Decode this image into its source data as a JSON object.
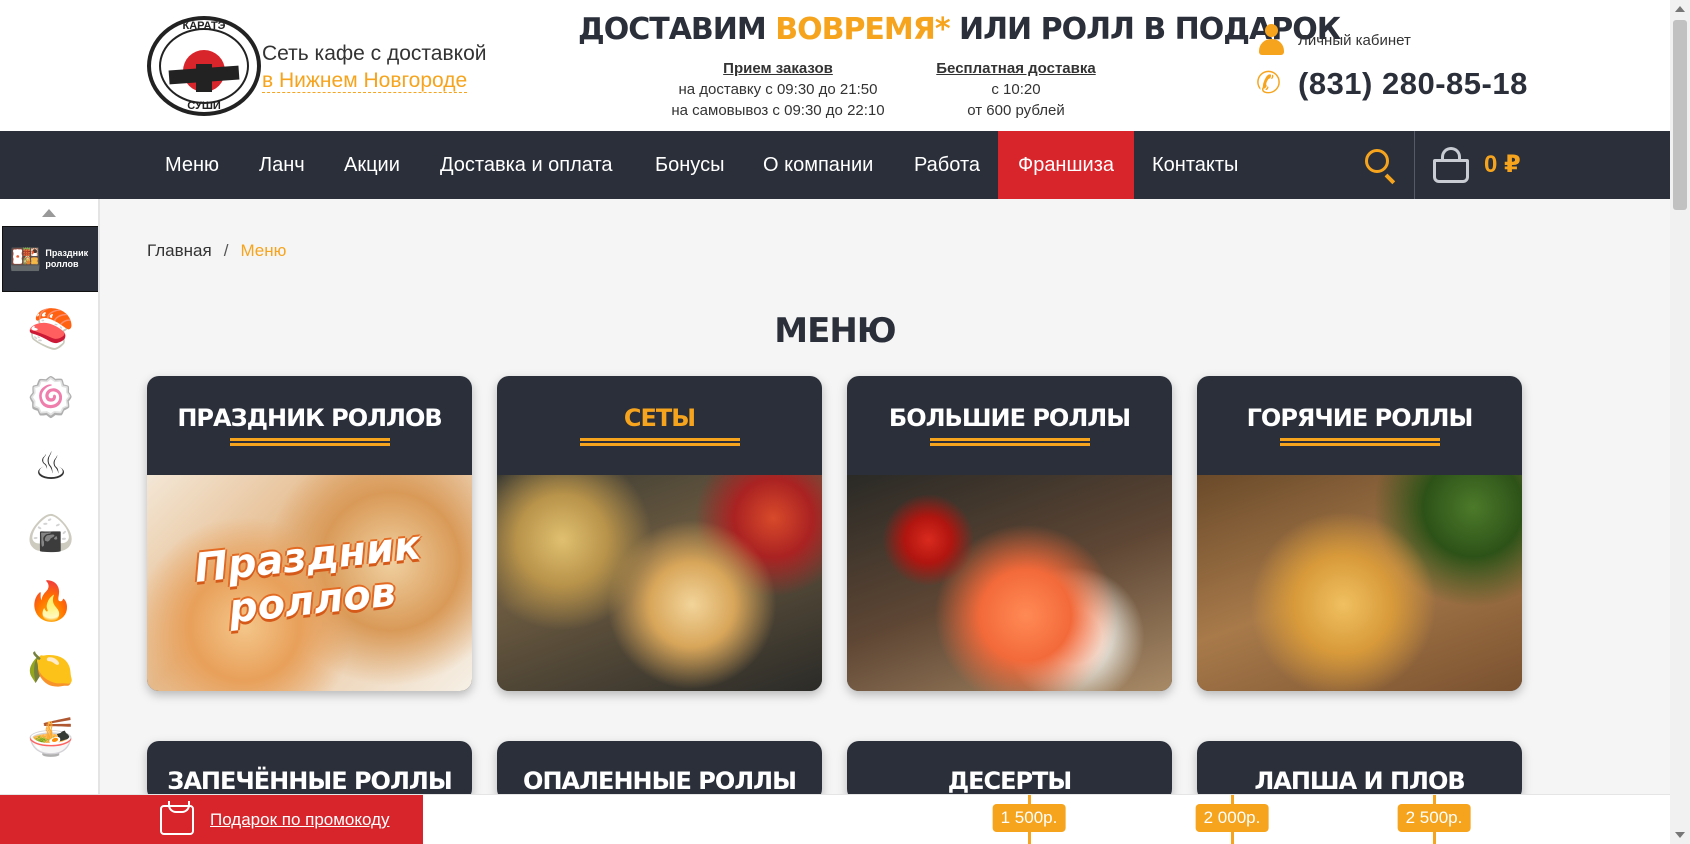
{
  "header": {
    "logo_top": "КАРАТЭ",
    "logo_bottom": "СУШИ",
    "tagline_line1": "Сеть кафе с доставкой",
    "tagline_city": "в Нижнем Новгороде",
    "promo_part1": "ДОСТАВИМ ",
    "promo_highlight": "ВОВРЕМЯ*",
    "promo_part2": " ИЛИ РОЛЛ В ПОДАРОК",
    "orders_title": "Прием заказов",
    "orders_line1": "на доставку с 09:30 до 21:50",
    "orders_line2": "на самовывоз с 09:30 до 22:10",
    "delivery_title": "Бесплатная доставка",
    "delivery_line1": "с 10:20",
    "delivery_line2": "от 600 рублей",
    "account_label": "Личный кабинет",
    "phone": "(831) 280-85-18"
  },
  "nav": {
    "items": [
      "Меню",
      "Ланч",
      "Акции",
      "Доставка и оплата",
      "Бонусы",
      "О компании",
      "Работа",
      "Франшиза",
      "Контакты"
    ],
    "cart_total": "0 ₽"
  },
  "sidebar": {
    "active_label": "Праздник роллов",
    "icons": [
      "rolls-icon",
      "sets-icon",
      "hot-rolls-icon",
      "baked-rolls-icon",
      "fire-rolls-icon",
      "lemon-rolls-icon",
      "noodles-icon"
    ]
  },
  "breadcrumb": {
    "home": "Главная",
    "separator": "/",
    "current": "Меню"
  },
  "page_title": "МЕНЮ",
  "categories": [
    {
      "name": "ПРАЗДНИК РОЛЛОВ",
      "image_text": "Праздник роллов"
    },
    {
      "name": "СЕТЫ"
    },
    {
      "name": "БОЛЬШИЕ РОЛЛЫ"
    },
    {
      "name": "ГОРЯЧИЕ РОЛЛЫ"
    }
  ],
  "categories_row2": [
    {
      "name": "ЗАПЕЧЁННЫЕ РОЛЛЫ"
    },
    {
      "name": "ОПАЛЕННЫЕ РОЛЛЫ"
    },
    {
      "name": "ДЕСЕРТЫ"
    },
    {
      "name": "ЛАПША И ПЛОВ"
    }
  ],
  "bottom_bar": {
    "gift_label": "Подарок по промокоду",
    "thresholds": [
      "1 500р.",
      "2 000р.",
      "2 500р."
    ]
  },
  "colors": {
    "accent": "#f6a41d",
    "dark": "#2a2f3a",
    "red": "#d8242b"
  }
}
